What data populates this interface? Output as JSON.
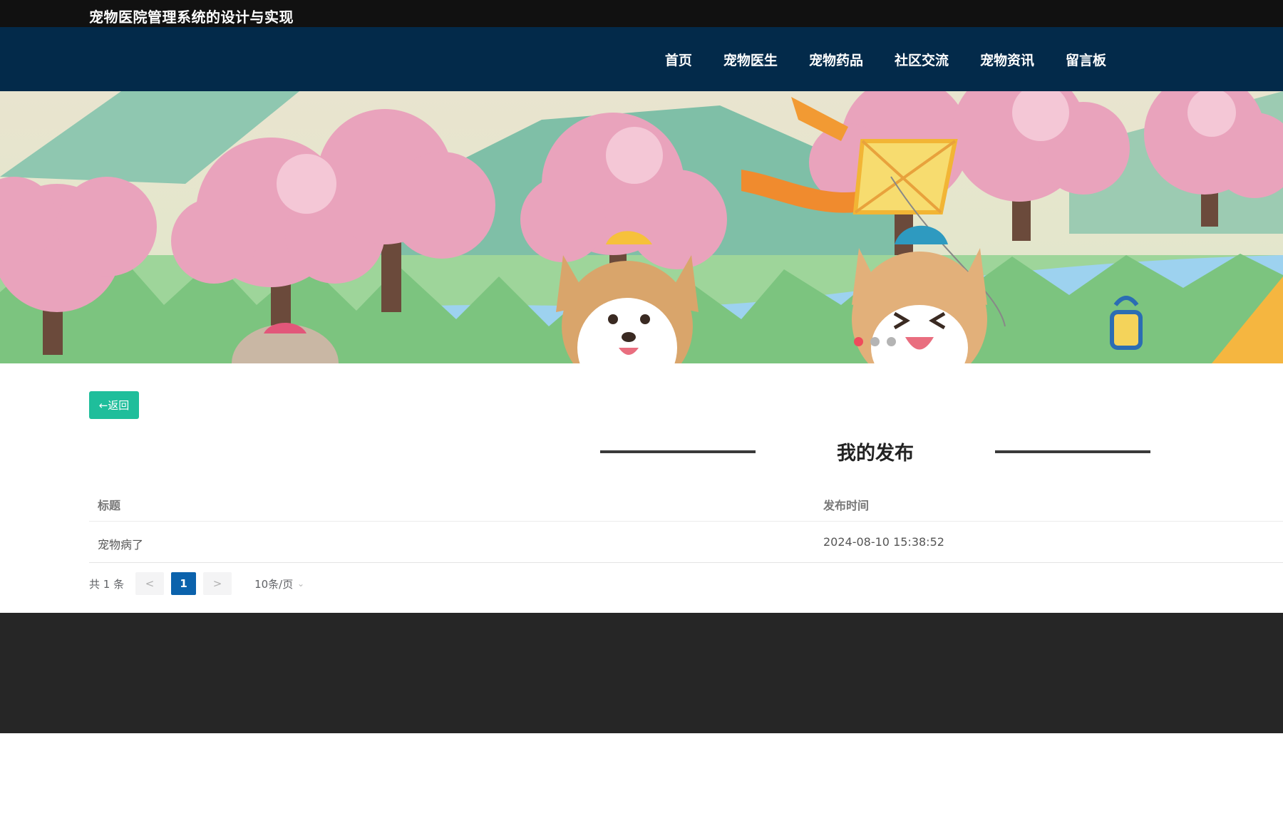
{
  "header": {
    "site_title": "宠物医院管理系统的设计与实现"
  },
  "nav": {
    "items": [
      "首页",
      "宠物医生",
      "宠物药品",
      "社区交流",
      "宠物资讯",
      "留言板"
    ]
  },
  "banner": {
    "slide_count": 3,
    "active_index": 0
  },
  "back_button": {
    "label": "←返回"
  },
  "section": {
    "title": "我的发布"
  },
  "table": {
    "columns": [
      "标题",
      "发布时间"
    ],
    "rows": [
      {
        "title": "宠物病了",
        "time": "2024-08-10 15:38:52"
      }
    ]
  },
  "pagination": {
    "total_text": "共 1 条",
    "prev": "<",
    "page": "1",
    "next": ">",
    "page_size": "10条/页"
  },
  "colors": {
    "topbar": "#111111",
    "navbar": "#032a4a",
    "accent_green": "#1fbe9b",
    "active_page": "#0b62ac",
    "footer": "#262626",
    "active_dot": "#ef4b5c"
  }
}
